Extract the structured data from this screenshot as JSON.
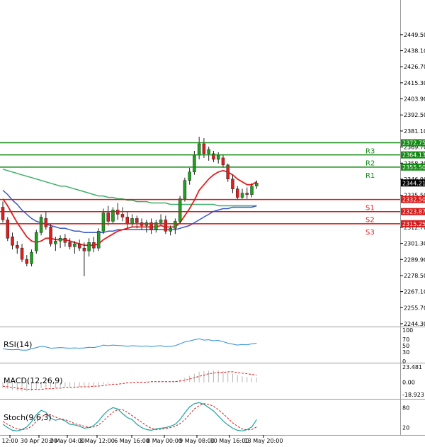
{
  "colors": {
    "bull": "#1fa11f",
    "bear": "#e01d1d",
    "wick": "#222222",
    "ema_fast": "#e51e1e",
    "ema_mid": "#3a57c8",
    "ema_slow": "#3fae6a",
    "resistance": "#138a13",
    "support": "#d61a1a",
    "rsi": "#2b8fd6",
    "macd_hist": "#b9b9b9",
    "macd_signal": "#d61a1a",
    "stoch_k": "#1ea3a3",
    "stoch_d": "#d61a1a",
    "current_box": "#000000"
  },
  "chart_data": {
    "type": "candlestick",
    "price_axis": {
      "ylim": [
        2244.3,
        2462.0
      ],
      "ticks": [
        "2449.50",
        "2438.10",
        "2426.70",
        "2415.30",
        "2403.90",
        "2392.50",
        "2381.10",
        "2369.70",
        "2358.30",
        "2346.90",
        "2335.50",
        "2312.70",
        "2301.30",
        "2289.90",
        "2278.50",
        "2267.10",
        "2255.70",
        "2244.30"
      ]
    },
    "time_labels": [
      "12:00",
      "30 Apr 20:00",
      "2 May 04:00",
      "3 May 12:00",
      "6 May 16:00",
      "8 May 00:00",
      "9 May 08:00",
      "10 May 16:00",
      "13 May 20:00"
    ],
    "candles": [
      {
        "o": 2327,
        "h": 2331,
        "l": 2316,
        "c": 2318
      },
      {
        "o": 2318,
        "h": 2320,
        "l": 2303,
        "c": 2305
      },
      {
        "o": 2306,
        "h": 2309,
        "l": 2297,
        "c": 2300
      },
      {
        "o": 2300,
        "h": 2303,
        "l": 2294,
        "c": 2298
      },
      {
        "o": 2298,
        "h": 2301,
        "l": 2288,
        "c": 2290
      },
      {
        "o": 2290,
        "h": 2293,
        "l": 2285,
        "c": 2287
      },
      {
        "o": 2287,
        "h": 2297,
        "l": 2285,
        "c": 2295
      },
      {
        "o": 2296,
        "h": 2311,
        "l": 2294,
        "c": 2309
      },
      {
        "o": 2309,
        "h": 2322,
        "l": 2307,
        "c": 2320
      },
      {
        "o": 2319,
        "h": 2324,
        "l": 2311,
        "c": 2313
      },
      {
        "o": 2313,
        "h": 2315,
        "l": 2299,
        "c": 2301
      },
      {
        "o": 2301,
        "h": 2306,
        "l": 2296,
        "c": 2303
      },
      {
        "o": 2303,
        "h": 2307,
        "l": 2298,
        "c": 2305
      },
      {
        "o": 2305,
        "h": 2308,
        "l": 2299,
        "c": 2302
      },
      {
        "o": 2302,
        "h": 2305,
        "l": 2297,
        "c": 2299
      },
      {
        "o": 2299,
        "h": 2303,
        "l": 2294,
        "c": 2301
      },
      {
        "o": 2301,
        "h": 2304,
        "l": 2296,
        "c": 2298
      },
      {
        "o": 2298,
        "h": 2302,
        "l": 2278,
        "c": 2296
      },
      {
        "o": 2296,
        "h": 2305,
        "l": 2292,
        "c": 2302
      },
      {
        "o": 2302,
        "h": 2306,
        "l": 2295,
        "c": 2298
      },
      {
        "o": 2298,
        "h": 2312,
        "l": 2296,
        "c": 2310
      },
      {
        "o": 2310,
        "h": 2326,
        "l": 2308,
        "c": 2323
      },
      {
        "o": 2323,
        "h": 2328,
        "l": 2314,
        "c": 2317
      },
      {
        "o": 2317,
        "h": 2327,
        "l": 2315,
        "c": 2325
      },
      {
        "o": 2325,
        "h": 2330,
        "l": 2318,
        "c": 2322
      },
      {
        "o": 2322,
        "h": 2327,
        "l": 2317,
        "c": 2320
      },
      {
        "o": 2320,
        "h": 2324,
        "l": 2312,
        "c": 2315
      },
      {
        "o": 2315,
        "h": 2322,
        "l": 2313,
        "c": 2319
      },
      {
        "o": 2319,
        "h": 2321,
        "l": 2312,
        "c": 2316
      },
      {
        "o": 2316,
        "h": 2319,
        "l": 2311,
        "c": 2314
      },
      {
        "o": 2314,
        "h": 2318,
        "l": 2309,
        "c": 2316
      },
      {
        "o": 2316,
        "h": 2319,
        "l": 2308,
        "c": 2311
      },
      {
        "o": 2311,
        "h": 2318,
        "l": 2309,
        "c": 2316
      },
      {
        "o": 2316,
        "h": 2322,
        "l": 2314,
        "c": 2318
      },
      {
        "o": 2318,
        "h": 2321,
        "l": 2308,
        "c": 2310
      },
      {
        "o": 2310,
        "h": 2314,
        "l": 2307,
        "c": 2312
      },
      {
        "o": 2312,
        "h": 2319,
        "l": 2308,
        "c": 2317
      },
      {
        "o": 2317,
        "h": 2335,
        "l": 2315,
        "c": 2333
      },
      {
        "o": 2333,
        "h": 2348,
        "l": 2331,
        "c": 2346
      },
      {
        "o": 2346,
        "h": 2355,
        "l": 2343,
        "c": 2352
      },
      {
        "o": 2352,
        "h": 2367,
        "l": 2350,
        "c": 2364
      },
      {
        "o": 2364,
        "h": 2377,
        "l": 2361,
        "c": 2372
      },
      {
        "o": 2372,
        "h": 2376,
        "l": 2362,
        "c": 2365
      },
      {
        "o": 2365,
        "h": 2370,
        "l": 2360,
        "c": 2368
      },
      {
        "o": 2365,
        "h": 2367,
        "l": 2359,
        "c": 2361
      },
      {
        "o": 2361,
        "h": 2366,
        "l": 2358,
        "c": 2364
      },
      {
        "o": 2362,
        "h": 2364,
        "l": 2355,
        "c": 2357
      },
      {
        "o": 2357,
        "h": 2358,
        "l": 2345,
        "c": 2347
      },
      {
        "o": 2347,
        "h": 2350,
        "l": 2337,
        "c": 2340
      },
      {
        "o": 2340,
        "h": 2342,
        "l": 2332,
        "c": 2334
      },
      {
        "o": 2334,
        "h": 2340,
        "l": 2333,
        "c": 2337
      },
      {
        "o": 2337,
        "h": 2341,
        "l": 2333,
        "c": 2336
      },
      {
        "o": 2336,
        "h": 2344,
        "l": 2334,
        "c": 2342
      },
      {
        "o": 2342,
        "h": 2346,
        "l": 2340,
        "c": 2344.21
      }
    ],
    "ema_fast": [
      2333,
      2328,
      2322,
      2316,
      2311,
      2306,
      2303,
      2302,
      2303,
      2305,
      2305,
      2304,
      2304,
      2304,
      2303,
      2302,
      2301,
      2300,
      2300,
      2300,
      2301,
      2304,
      2306,
      2308,
      2310,
      2311,
      2312,
      2313,
      2313,
      2313,
      2313,
      2313,
      2313,
      2314,
      2313,
      2313,
      2313,
      2316,
      2321,
      2326,
      2332,
      2339,
      2343,
      2347,
      2350,
      2352,
      2353,
      2352,
      2350,
      2347,
      2345,
      2343,
      2343,
      2345
    ],
    "ema_mid": [
      2339,
      2336,
      2332,
      2329,
      2325,
      2322,
      2319,
      2317,
      2316,
      2315,
      2314,
      2313,
      2312,
      2312,
      2311,
      2310,
      2310,
      2309,
      2309,
      2309,
      2309,
      2309,
      2310,
      2310,
      2311,
      2311,
      2311,
      2311,
      2311,
      2311,
      2311,
      2311,
      2311,
      2311,
      2311,
      2311,
      2311,
      2312,
      2313,
      2314,
      2316,
      2318,
      2320,
      2322,
      2324,
      2325,
      2326,
      2326,
      2327,
      2327,
      2327,
      2327,
      2327,
      2328
    ],
    "ema_slow": [
      2354,
      2353,
      2352,
      2351,
      2350,
      2349,
      2348,
      2347,
      2346,
      2345,
      2344,
      2343,
      2342,
      2342,
      2341,
      2340,
      2339,
      2338,
      2337,
      2336,
      2335,
      2335,
      2334,
      2334,
      2333,
      2333,
      2332,
      2332,
      2331,
      2331,
      2331,
      2330,
      2330,
      2330,
      2330,
      2329,
      2329,
      2329,
      2329,
      2329,
      2329,
      2329,
      2329,
      2329,
      2329,
      2328,
      2328,
      2328,
      2328,
      2328,
      2328,
      2328,
      2328,
      2328
    ],
    "levels": [
      {
        "name": "R3",
        "value": 2372.75,
        "label": "2372.75",
        "kind": "resistance"
      },
      {
        "name": "R2",
        "value": 2364.13,
        "label": "2364.13",
        "kind": "resistance"
      },
      {
        "name": "R1",
        "value": 2355.5,
        "label": "2355.50",
        "kind": "resistance"
      },
      {
        "name": "S1",
        "value": 2332.5,
        "label": "2332.50",
        "kind": "support"
      },
      {
        "name": "S2",
        "value": 2323.87,
        "label": "2323.87",
        "kind": "support"
      },
      {
        "name": "S3",
        "value": 2315.25,
        "label": "2315.25",
        "kind": "support"
      }
    ],
    "current_price": "2344.21",
    "rsi": {
      "title": "RSI(14)",
      "ylim": [
        0,
        100
      ],
      "ticks": [
        "100",
        "70",
        "50",
        "30",
        "0"
      ],
      "values": [
        40,
        38,
        37,
        38,
        36,
        36,
        40,
        44,
        48,
        46,
        42,
        43,
        44,
        43,
        42,
        43,
        42,
        43,
        45,
        44,
        47,
        52,
        50,
        52,
        51,
        50,
        48,
        50,
        49,
        48,
        49,
        47,
        49,
        50,
        47,
        48,
        50,
        56,
        62,
        65,
        69,
        72,
        68,
        69,
        66,
        67,
        63,
        58,
        55,
        52,
        54,
        53,
        56,
        58
      ]
    },
    "macd": {
      "title": "MACD(12,26,9)",
      "ylim": [
        -18.923,
        23.481
      ],
      "ticks": [
        "23.481",
        "0.00",
        "-18.923"
      ],
      "hist": [
        -9,
        -10,
        -12,
        -13,
        -14,
        -14,
        -13,
        -11,
        -9,
        -8,
        -8,
        -8,
        -7,
        -7,
        -7,
        -7,
        -7,
        -6,
        -6,
        -6,
        -5,
        -3,
        -2,
        -1,
        0,
        0,
        0,
        1,
        1,
        1,
        1,
        1,
        1,
        1,
        1,
        1,
        2,
        4,
        7,
        10,
        13,
        16,
        17,
        18,
        18,
        18,
        17,
        15,
        13,
        11,
        9,
        8,
        7,
        7
      ],
      "signal": [
        -6,
        -7,
        -8,
        -9,
        -10,
        -11,
        -11,
        -11,
        -11,
        -10,
        -10,
        -9,
        -9,
        -8,
        -8,
        -8,
        -7,
        -7,
        -7,
        -6,
        -6,
        -5,
        -4,
        -3,
        -3,
        -2,
        -1,
        -1,
        0,
        0,
        0,
        1,
        1,
        1,
        1,
        1,
        1,
        2,
        3,
        5,
        7,
        9,
        11,
        13,
        14,
        15,
        15,
        16,
        16,
        15,
        14,
        13,
        12,
        11
      ]
    },
    "stoch": {
      "title": "Stoch(9,6,3)",
      "ylim": [
        0,
        100
      ],
      "ticks": [
        "80",
        "20"
      ],
      "k": [
        30,
        20,
        12,
        10,
        14,
        22,
        38,
        58,
        72,
        66,
        48,
        42,
        46,
        40,
        30,
        28,
        24,
        18,
        20,
        26,
        40,
        58,
        72,
        80,
        76,
        62,
        50,
        44,
        30,
        20,
        14,
        12,
        16,
        18,
        20,
        24,
        30,
        44,
        64,
        82,
        92,
        95,
        90,
        80,
        70,
        55,
        40,
        28,
        18,
        12,
        10,
        14,
        22,
        44
      ],
      "d": [
        38,
        30,
        22,
        16,
        14,
        16,
        24,
        38,
        52,
        60,
        58,
        52,
        46,
        44,
        38,
        32,
        28,
        24,
        20,
        22,
        28,
        40,
        54,
        66,
        74,
        74,
        66,
        56,
        46,
        36,
        26,
        18,
        14,
        15,
        17,
        20,
        24,
        32,
        44,
        60,
        76,
        86,
        92,
        90,
        84,
        74,
        62,
        48,
        34,
        24,
        16,
        13,
        14,
        22
      ]
    }
  }
}
